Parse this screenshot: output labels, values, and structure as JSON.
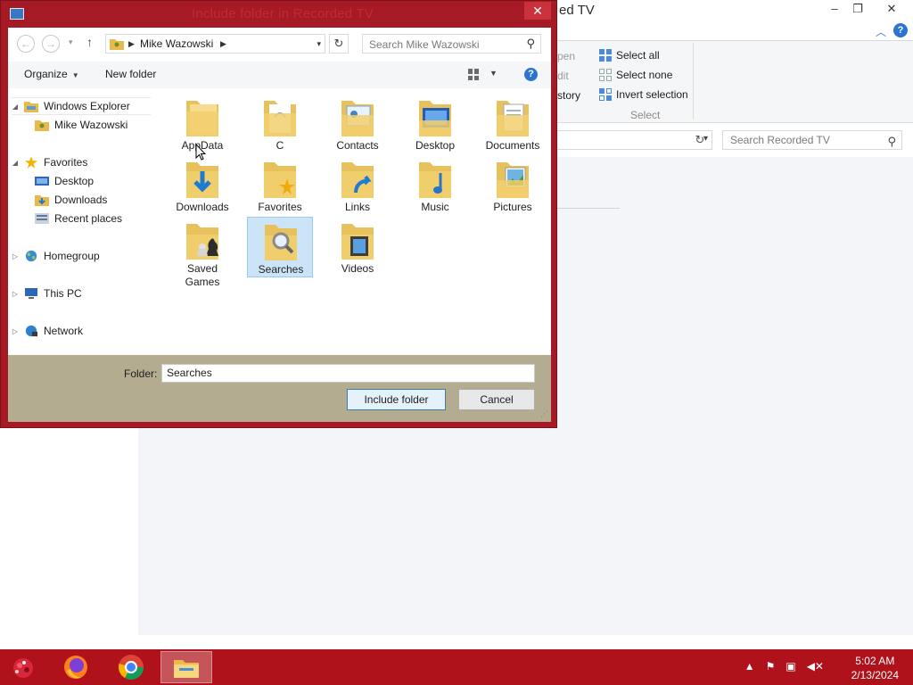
{
  "background_window": {
    "title_partial": "ed TV",
    "controls": {
      "minimize": "–",
      "restore": "❐",
      "close": "✕"
    },
    "ribbon_partials": [
      "pen",
      "dit",
      "story"
    ],
    "select_group": {
      "items": [
        "Select all",
        "Select none",
        "Invert selection"
      ],
      "group_label": "Select"
    },
    "search_placeholder": "Search Recorded TV"
  },
  "dialog": {
    "title": "Include folder in Recorded TV",
    "close_glyph": "✕",
    "address": {
      "location": "Mike Wazowski"
    },
    "search_placeholder": "Search Mike Wazowski",
    "toolbar": {
      "organize": "Organize",
      "new_folder": "New folder",
      "help": "?"
    },
    "nav_pane": [
      {
        "label": "Windows Explorer",
        "icon": "explorer-icon",
        "level": 0,
        "arrow": "◢"
      },
      {
        "label": "Mike Wazowski",
        "icon": "user-folder-icon",
        "level": 1,
        "arrow": ""
      },
      {
        "label": "Favorites",
        "icon": "star-icon",
        "level": 0,
        "arrow": "◢"
      },
      {
        "label": "Desktop",
        "icon": "desktop-icon",
        "level": 1,
        "arrow": ""
      },
      {
        "label": "Downloads",
        "icon": "downloads-icon",
        "level": 1,
        "arrow": ""
      },
      {
        "label": "Recent places",
        "icon": "recent-places-icon",
        "level": 1,
        "arrow": ""
      },
      {
        "label": "Homegroup",
        "icon": "homegroup-icon",
        "level": 0,
        "arrow": "▷"
      },
      {
        "label": "This PC",
        "icon": "computer-icon",
        "level": 0,
        "arrow": "▷"
      },
      {
        "label": "Network",
        "icon": "network-icon",
        "level": 0,
        "arrow": "▷"
      }
    ],
    "folders": [
      {
        "label": "AppData",
        "overlay": "none",
        "selected": false
      },
      {
        "label": "C",
        "overlay": "shortcut",
        "selected": false
      },
      {
        "label": "Contacts",
        "overlay": "contacts",
        "selected": false
      },
      {
        "label": "Desktop",
        "overlay": "desktop",
        "selected": false
      },
      {
        "label": "Documents",
        "overlay": "documents",
        "selected": false
      },
      {
        "label": "Downloads",
        "overlay": "download-arrow",
        "selected": false
      },
      {
        "label": "Favorites",
        "overlay": "star",
        "selected": false
      },
      {
        "label": "Links",
        "overlay": "link-arrow",
        "selected": false
      },
      {
        "label": "Music",
        "overlay": "music-note",
        "selected": false
      },
      {
        "label": "Pictures",
        "overlay": "picture",
        "selected": false
      },
      {
        "label": "Saved Games",
        "overlay": "chess-pieces",
        "selected": false
      },
      {
        "label": "Searches",
        "overlay": "magnifier",
        "selected": true
      },
      {
        "label": "Videos",
        "overlay": "film",
        "selected": false
      }
    ],
    "footer": {
      "folder_label": "Folder:",
      "folder_value": "Searches",
      "include_button": "Include folder",
      "cancel_button": "Cancel"
    }
  },
  "taskbar": {
    "apps": [
      "firefox-icon",
      "chrome-icon",
      "file-explorer-icon"
    ],
    "active_app": "file-explorer-icon",
    "tray_icons": [
      "show-hidden-icons",
      "action-center-flag-icon",
      "network-icon",
      "volume-muted-icon"
    ],
    "time": "5:02 AM",
    "date": "2/13/2024"
  },
  "colors": {
    "accent": "#a51a24",
    "taskbar": "#b0121c",
    "selection": "#cce4f7",
    "footer": "#b3ac90",
    "folder": "#f2cf6e"
  }
}
